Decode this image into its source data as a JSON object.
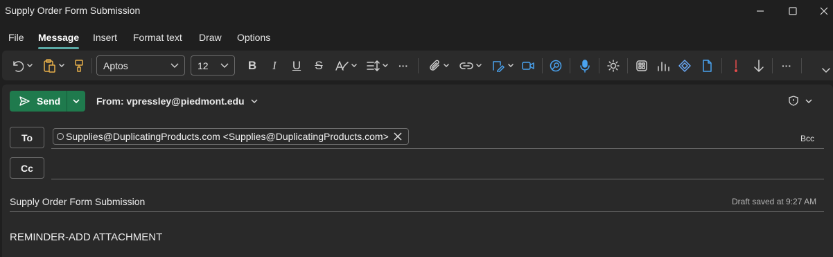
{
  "window": {
    "title": "Supply Order Form Submission"
  },
  "menu": {
    "tabs": [
      {
        "label": "File"
      },
      {
        "label": "Message"
      },
      {
        "label": "Insert"
      },
      {
        "label": "Format text"
      },
      {
        "label": "Draw"
      },
      {
        "label": "Options"
      }
    ],
    "active_tab": "Message"
  },
  "ribbon": {
    "font_name": "Aptos",
    "font_size": "12",
    "bold_glyph": "B",
    "italic_glyph": "I",
    "underline_glyph": "U",
    "strike_glyph": "S",
    "more_glyph": "···",
    "icons": [
      "undo-icon",
      "paste-icon",
      "format-painter-icon",
      "styles-icon",
      "paragraph-icon",
      "attach-icon",
      "link-icon",
      "signature-icon",
      "meeting-icon",
      "copilot-icon",
      "dictate-icon",
      "immersive-reader-icon",
      "apps-icon",
      "insights-icon",
      "loop-icon",
      "forms-icon",
      "high-importance-icon",
      "low-importance-icon"
    ],
    "accent_color": "#5aa9a5"
  },
  "compose": {
    "send_label": "Send",
    "send_color": "#1f7a4d",
    "from_label": "From: vpressley@piedmont.edu",
    "to_label": "To",
    "cc_label": "Cc",
    "bcc_label": "Bcc",
    "recipients": [
      {
        "display": "Supplies@DuplicatingProducts.com <Supplies@DuplicatingProducts.com>"
      }
    ],
    "subject": "Supply Order Form Submission",
    "draft_status": "Draft saved at 9:27 AM",
    "body_text": "REMINDER-ADD ATTACHMENT"
  }
}
